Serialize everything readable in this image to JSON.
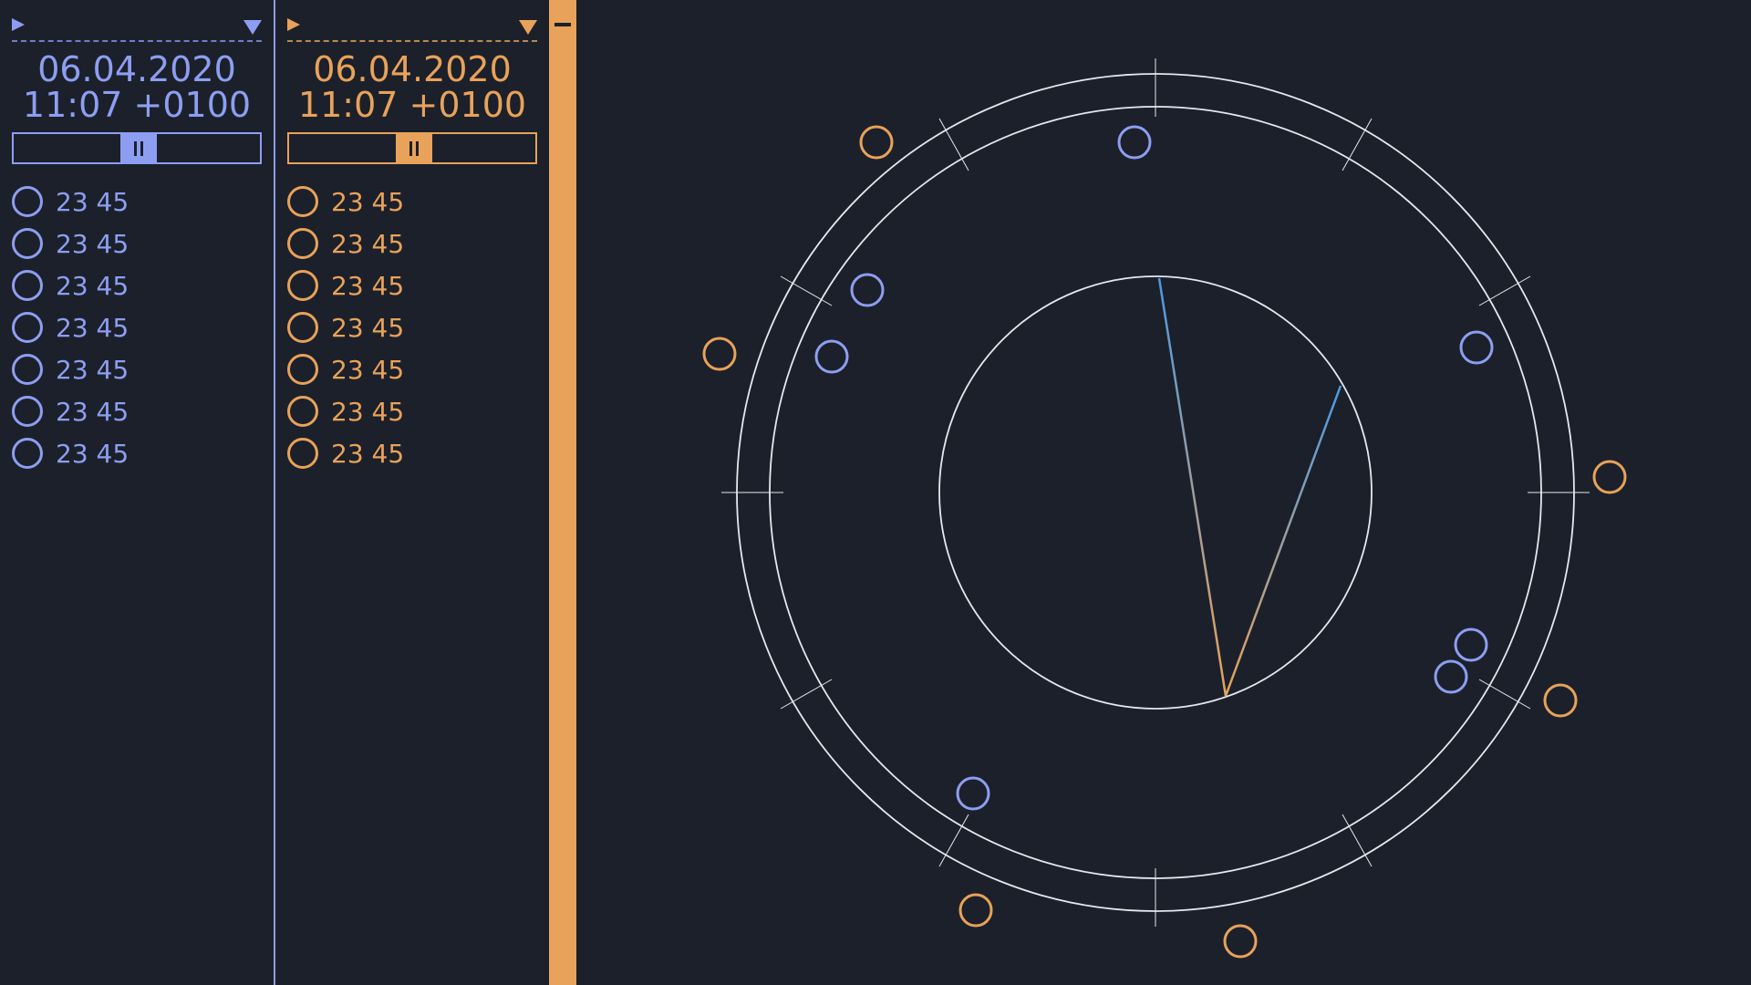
{
  "panel_a": {
    "date": "06.04.2020",
    "time": "11:07 +0100",
    "color": "#8d9ef2",
    "rows": [
      "23 45",
      "23 45",
      "23 45",
      "23 45",
      "23 45",
      "23 45",
      "23 45"
    ]
  },
  "panel_b": {
    "date": "06.04.2020",
    "time": "11:07 +0100",
    "color": "#e8a25a",
    "rows": [
      "23 45",
      "23 45",
      "23 45",
      "23 45",
      "23 45",
      "23 45",
      "23 45"
    ]
  },
  "icons": {
    "play": "play-icon",
    "dropdown": "chevron-down-icon",
    "pause": "pause-icon",
    "collapse": "minus-icon"
  }
}
